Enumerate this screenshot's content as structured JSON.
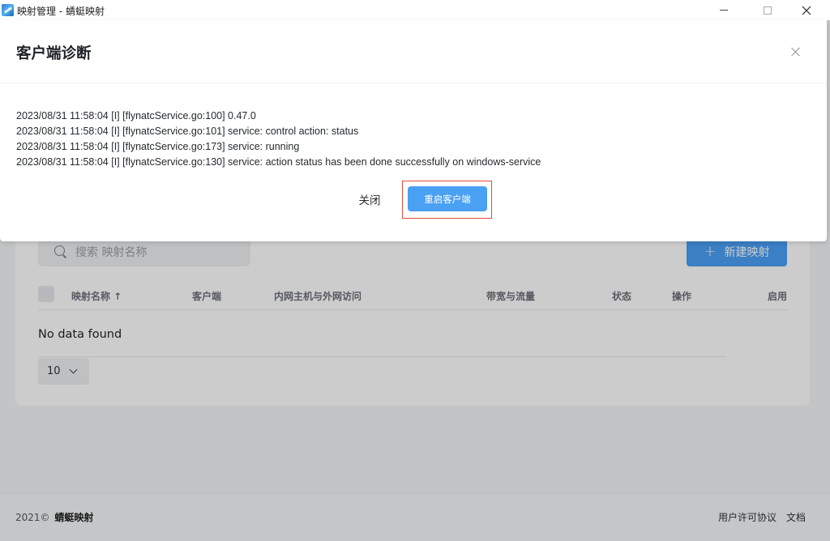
{
  "window": {
    "title": "映射管理 - 蜻蜓映射",
    "controls": [
      "minimize",
      "maximize",
      "close"
    ]
  },
  "page": {
    "search": {
      "placeholder": "搜索 映射名称"
    },
    "new_button": {
      "icon": "plus-icon",
      "label": "新建映射"
    },
    "table": {
      "columns": [
        "映射名称 ↑",
        "客户端",
        "内网主机与外网访问",
        "带宽与流量",
        "状态",
        "操作",
        "启用"
      ],
      "empty_text": "No data found"
    },
    "pagination": {
      "page_size": "10"
    },
    "footer": {
      "copyright": "2021©",
      "brand": "蜻蜓映射",
      "links": [
        "用户许可协议",
        "文档"
      ]
    }
  },
  "dialog": {
    "title": "客户端诊断",
    "log_lines": [
      "2023/08/31 11:58:04 [I] [flynatcService.go:100] 0.47.0",
      "2023/08/31 11:58:04 [I] [flynatcService.go:101] service: control action: status",
      "2023/08/31 11:58:04 [I] [flynatcService.go:173] service: running",
      "2023/08/31 11:58:04 [I] [flynatcService.go:130] service: action status has been done successfully on windows-service"
    ],
    "close_label": "关闭",
    "restart_label": "重启客户端",
    "colors": {
      "primary": "#4aa0f3",
      "highlight": "#e04a3a"
    }
  }
}
